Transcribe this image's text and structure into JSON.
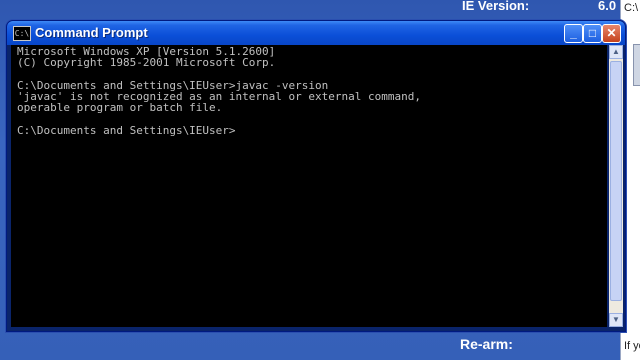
{
  "desktop": {
    "ie_version_label": "IE Version:",
    "ie_version_value": "6.0",
    "rearm_label": "Re-arm:"
  },
  "side_window": {
    "text_top": "C:\\",
    "text_bottom": "If yo"
  },
  "window": {
    "title": "Command Prompt",
    "icon_text": "C:\\",
    "minimize": "_",
    "maximize": "□",
    "close": "✕"
  },
  "console": {
    "lines": [
      "Microsoft Windows XP [Version 5.1.2600]",
      "(C) Copyright 1985-2001 Microsoft Corp.",
      "",
      "C:\\Documents and Settings\\IEUser>javac -version",
      "'javac' is not recognized as an internal or external command,",
      "operable program or batch file.",
      "",
      "C:\\Documents and Settings\\IEUser>"
    ]
  },
  "colors": {
    "titlebar": "#0b4fd8",
    "console_bg": "#000000",
    "console_text": "#c0c0c0",
    "desktop": "#3560b8"
  },
  "icons": [
    "console-app-icon",
    "minimize-icon",
    "maximize-icon",
    "close-icon",
    "scroll-up-arrow-icon",
    "scroll-down-arrow-icon"
  ]
}
